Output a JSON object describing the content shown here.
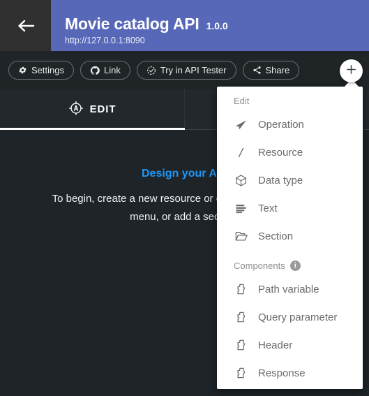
{
  "header": {
    "back_icon": "arrow-left-icon",
    "title": "Movie catalog API",
    "version": "1.0.0",
    "url": "http://127.0.0.1:8090",
    "bg_color": "#5868b8"
  },
  "toolbar": {
    "buttons": [
      {
        "label": "Settings",
        "icon": "gear-icon"
      },
      {
        "label": "Link",
        "icon": "github-icon"
      },
      {
        "label": "Try in API Tester",
        "icon": "check-circle-icon"
      },
      {
        "label": "Share",
        "icon": "share-icon"
      }
    ],
    "fab": {
      "icon": "plus-icon",
      "color": "#37474f",
      "bg": "#ffffff"
    }
  },
  "tabs": [
    {
      "label": "EDIT",
      "icon": "compass-icon",
      "active": true
    }
  ],
  "content": {
    "heading": "Design your API",
    "body": "To begin, create a new resource or operation from the “+” menu, or add a section.",
    "heading_color": "#2196f3"
  },
  "menu": {
    "groups": [
      {
        "label": "Edit",
        "has_info": false,
        "items": [
          {
            "label": "Operation",
            "icon": "send-icon"
          },
          {
            "label": "Resource",
            "icon": "slash-icon"
          },
          {
            "label": "Data type",
            "icon": "cube-icon"
          },
          {
            "label": "Text",
            "icon": "text-lines-icon"
          },
          {
            "label": "Section",
            "icon": "folder-open-icon"
          }
        ]
      },
      {
        "label": "Components",
        "has_info": true,
        "info_icon": "info-icon",
        "items": [
          {
            "label": "Path variable",
            "icon": "puzzle-icon"
          },
          {
            "label": "Query parameter",
            "icon": "puzzle-icon"
          },
          {
            "label": "Header",
            "icon": "puzzle-icon"
          },
          {
            "label": "Response",
            "icon": "puzzle-icon"
          }
        ]
      }
    ]
  }
}
